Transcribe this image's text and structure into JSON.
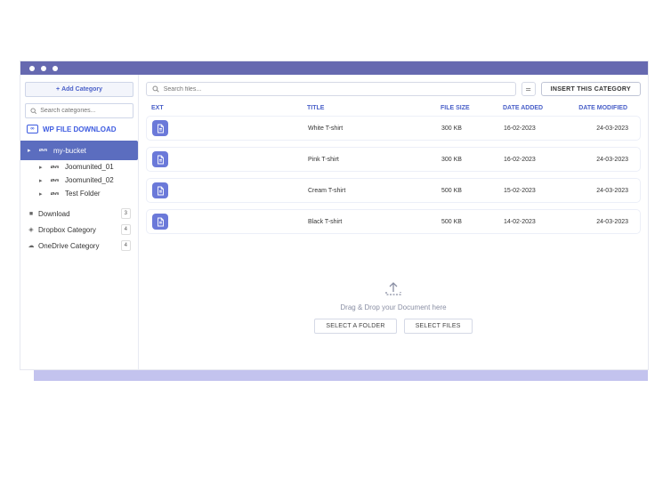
{
  "sidebar": {
    "add_category_label": "Add Category",
    "search_placeholder": "Search categories...",
    "app_name": "WP FILE DOWNLOAD",
    "aws_label": "aws",
    "selected_bucket": "my-bucket",
    "sub_buckets": [
      "Joomunited_01",
      "Joomunited_02",
      "Test Folder"
    ],
    "dl_label": "Download",
    "dl_count": "3",
    "dbx_label": "Dropbox Category",
    "dbx_count": "4",
    "od_label": "OneDrive Category",
    "od_count": "4"
  },
  "toolbar": {
    "search_placeholder": "Search files...",
    "insert_label": "INSERT THIS CATEGORY"
  },
  "headers": {
    "ext": "EXT",
    "title": "TITLE",
    "size": "FILE SIZE",
    "added": "DATE ADDED",
    "mod": "DATE MODIFIED"
  },
  "files": [
    {
      "title": "White T-shirt",
      "size": "300 KB",
      "added": "16-02-2023",
      "modified": "24-03-2023"
    },
    {
      "title": "Pink T-shirt",
      "size": "300 KB",
      "added": "16-02-2023",
      "modified": "24-03-2023"
    },
    {
      "title": "Cream T-shirt",
      "size": "500 KB",
      "added": "15-02-2023",
      "modified": "24-03-2023"
    },
    {
      "title": "Black T-shirt",
      "size": "500 KB",
      "added": "14-02-2023",
      "modified": "24-03-2023"
    }
  ],
  "dropzone": {
    "label": "Drag & Drop your Document here",
    "folder_btn": "SELECT A FOLDER",
    "files_btn": "SELECT FILES"
  }
}
